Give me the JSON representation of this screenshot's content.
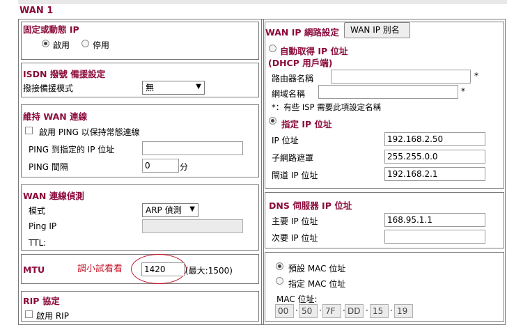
{
  "wan_title": "WAN 1",
  "left": {
    "ip_type": {
      "title": "固定或動態 IP",
      "enable": "啟用",
      "disable": "停用"
    },
    "isdn": {
      "title": "ISDN 撥號 備援設定",
      "mode_label": "撥接備援模式",
      "mode_value": "無"
    },
    "keep_alive": {
      "title": "維持 WAN 連線",
      "ping_enable": "啟用 PING 以保持常態連線",
      "ping_ip_label": "PING 到指定的 IP 位址",
      "ping_ip_value": "",
      "interval_label": "PING 間隔",
      "interval_value": "0",
      "interval_unit": "分"
    },
    "detect": {
      "title": "WAN 連線偵測",
      "mode_label": "模式",
      "mode_value": "ARP 偵測",
      "ping_ip_label": "Ping IP",
      "ttl_label": "TTL:"
    },
    "mtu": {
      "label": "MTU",
      "note": "調小試看看",
      "value": "1420",
      "max": "(最大:1500)"
    },
    "rip": {
      "title": "RIP 協定",
      "enable": "啟用 RIP"
    }
  },
  "right": {
    "title": "WAN IP 網路設定",
    "alias_button": "WAN IP 別名",
    "auto": {
      "label": "自動取得 IP 位址",
      "sub": "(DHCP 用戶端)",
      "router_name_label": "路由器名稱",
      "router_name_value": "",
      "domain_label": "網域名稱",
      "domain_value": "",
      "asterisk": "*",
      "note": "*：有些 ISP 需要此項設定名稱"
    },
    "static": {
      "label": "指定 IP 位址",
      "ip_label": "IP 位址",
      "ip_value": "192.168.2.50",
      "mask_label": "子網路遮罩",
      "mask_value": "255.255.0.0",
      "gateway_label": "閘道 IP 位址",
      "gateway_value": "192.168.2.1"
    },
    "dns": {
      "title": "DNS 伺服器 IP 位址",
      "primary_label": "主要 IP 位址",
      "primary_value": "168.95.1.1",
      "secondary_label": "次要 IP 位址",
      "secondary_value": ""
    },
    "mac": {
      "default_label": "預設 MAC 位址",
      "specify_label": "指定 MAC 位址",
      "addr_label": "MAC 位址:",
      "octets": [
        "00",
        "50",
        "7F",
        "DD",
        "15",
        "19"
      ],
      "separator": "·"
    }
  },
  "colors": {
    "section_title": "#8b0a3a",
    "annotation": "#c3172c"
  }
}
